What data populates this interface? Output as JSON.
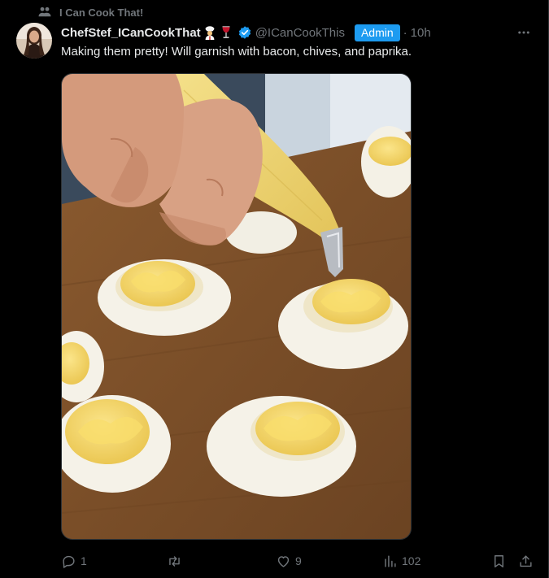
{
  "context": {
    "icon": "community-icon",
    "label": "I Can Cook That!"
  },
  "post": {
    "display_name": "ChefStef_ICanCookThat",
    "emojis": [
      "chef-emoji",
      "wine-glass-emoji"
    ],
    "verified_icon": "verified-badge-icon",
    "handle": "@ICanCookThis",
    "badge": "Admin",
    "separator": "·",
    "time": "10h",
    "text": "Making them pretty! Will garnish with bacon, chives, and paprika.",
    "more_icon": "more-options-icon"
  },
  "media": {
    "icon": "photo-of-deviled-eggs-being-piped"
  },
  "actions": {
    "reply_count": "1",
    "repost_count": "",
    "like_count": "9",
    "view_count": "102"
  },
  "colors": {
    "background": "#000000",
    "text": "#e7e9ea",
    "muted": "#71767b",
    "accent": "#1d9bf0",
    "border": "#2f3336"
  }
}
